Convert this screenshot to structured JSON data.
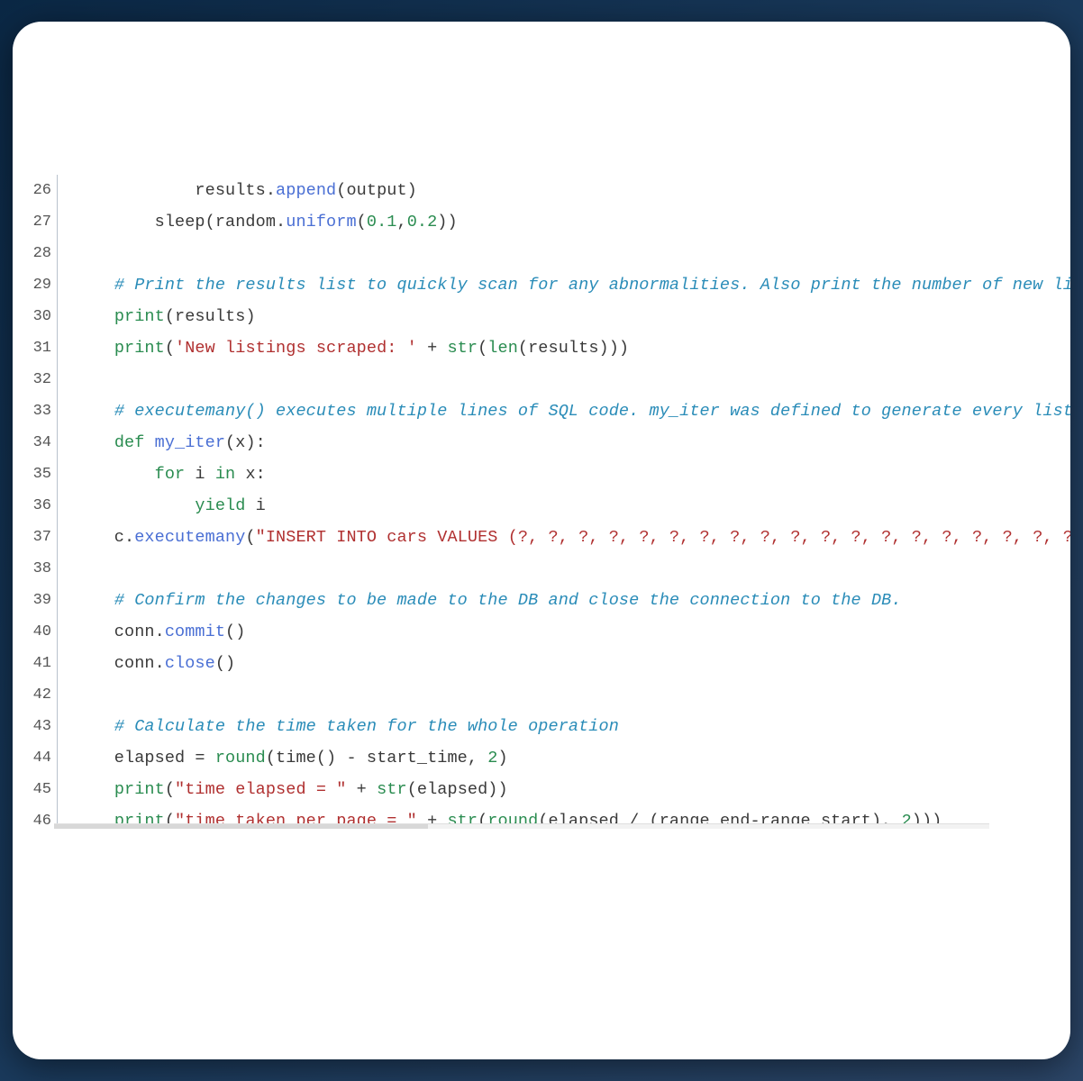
{
  "code": {
    "lines": [
      {
        "n": 26,
        "tokens": [
          {
            "t": "            results.",
            "c": "t-default"
          },
          {
            "t": "append",
            "c": "t-func"
          },
          {
            "t": "(output)",
            "c": "t-default"
          }
        ]
      },
      {
        "n": 27,
        "tokens": [
          {
            "t": "        sleep(random.",
            "c": "t-default"
          },
          {
            "t": "uniform",
            "c": "t-func"
          },
          {
            "t": "(",
            "c": "t-default"
          },
          {
            "t": "0.1",
            "c": "t-num"
          },
          {
            "t": ",",
            "c": "t-default"
          },
          {
            "t": "0.2",
            "c": "t-num"
          },
          {
            "t": "))",
            "c": "t-default"
          }
        ]
      },
      {
        "n": 28,
        "tokens": [
          {
            "t": "",
            "c": "t-default"
          }
        ]
      },
      {
        "n": 29,
        "tokens": [
          {
            "t": "    ",
            "c": "t-default"
          },
          {
            "t": "# Print the results list to quickly scan for any abnormalities. Also print the number of new li",
            "c": "t-comment"
          }
        ]
      },
      {
        "n": 30,
        "tokens": [
          {
            "t": "    ",
            "c": "t-default"
          },
          {
            "t": "print",
            "c": "t-builtin"
          },
          {
            "t": "(results)",
            "c": "t-default"
          }
        ]
      },
      {
        "n": 31,
        "tokens": [
          {
            "t": "    ",
            "c": "t-default"
          },
          {
            "t": "print",
            "c": "t-builtin"
          },
          {
            "t": "(",
            "c": "t-default"
          },
          {
            "t": "'New listings scraped: '",
            "c": "t-string"
          },
          {
            "t": " + ",
            "c": "t-default"
          },
          {
            "t": "str",
            "c": "t-builtin"
          },
          {
            "t": "(",
            "c": "t-default"
          },
          {
            "t": "len",
            "c": "t-builtin"
          },
          {
            "t": "(results)))",
            "c": "t-default"
          }
        ]
      },
      {
        "n": 32,
        "tokens": [
          {
            "t": "",
            "c": "t-default"
          }
        ]
      },
      {
        "n": 33,
        "tokens": [
          {
            "t": "    ",
            "c": "t-default"
          },
          {
            "t": "# executemany() executes multiple lines of SQL code. my_iter was defined to generate every list",
            "c": "t-comment"
          }
        ]
      },
      {
        "n": 34,
        "tokens": [
          {
            "t": "    ",
            "c": "t-default"
          },
          {
            "t": "def",
            "c": "t-keyword"
          },
          {
            "t": " ",
            "c": "t-default"
          },
          {
            "t": "my_iter",
            "c": "t-func"
          },
          {
            "t": "(x):",
            "c": "t-default"
          }
        ]
      },
      {
        "n": 35,
        "tokens": [
          {
            "t": "        ",
            "c": "t-default"
          },
          {
            "t": "for",
            "c": "t-keyword"
          },
          {
            "t": " i ",
            "c": "t-default"
          },
          {
            "t": "in",
            "c": "t-keyword"
          },
          {
            "t": " x:",
            "c": "t-default"
          }
        ]
      },
      {
        "n": 36,
        "tokens": [
          {
            "t": "            ",
            "c": "t-default"
          },
          {
            "t": "yield",
            "c": "t-keyword"
          },
          {
            "t": " i",
            "c": "t-default"
          }
        ]
      },
      {
        "n": 37,
        "tokens": [
          {
            "t": "    c.",
            "c": "t-default"
          },
          {
            "t": "executemany",
            "c": "t-func"
          },
          {
            "t": "(",
            "c": "t-default"
          },
          {
            "t": "\"INSERT INTO cars VALUES (?, ?, ?, ?, ?, ?, ?, ?, ?, ?, ?, ?, ?, ?, ?, ?, ?, ?, ?",
            "c": "t-string"
          }
        ]
      },
      {
        "n": 38,
        "tokens": [
          {
            "t": "",
            "c": "t-default"
          }
        ]
      },
      {
        "n": 39,
        "tokens": [
          {
            "t": "    ",
            "c": "t-default"
          },
          {
            "t": "# Confirm the changes to be made to the DB and close the connection to the DB.",
            "c": "t-comment"
          }
        ]
      },
      {
        "n": 40,
        "tokens": [
          {
            "t": "    conn.",
            "c": "t-default"
          },
          {
            "t": "commit",
            "c": "t-func"
          },
          {
            "t": "()",
            "c": "t-default"
          }
        ]
      },
      {
        "n": 41,
        "tokens": [
          {
            "t": "    conn.",
            "c": "t-default"
          },
          {
            "t": "close",
            "c": "t-func"
          },
          {
            "t": "()",
            "c": "t-default"
          }
        ]
      },
      {
        "n": 42,
        "tokens": [
          {
            "t": "",
            "c": "t-default"
          }
        ]
      },
      {
        "n": 43,
        "tokens": [
          {
            "t": "    ",
            "c": "t-default"
          },
          {
            "t": "# Calculate the time taken for the whole operation",
            "c": "t-comment"
          }
        ]
      },
      {
        "n": 44,
        "tokens": [
          {
            "t": "    elapsed = ",
            "c": "t-default"
          },
          {
            "t": "round",
            "c": "t-builtin"
          },
          {
            "t": "(time() - start_time, ",
            "c": "t-default"
          },
          {
            "t": "2",
            "c": "t-num"
          },
          {
            "t": ")",
            "c": "t-default"
          }
        ]
      },
      {
        "n": 45,
        "tokens": [
          {
            "t": "    ",
            "c": "t-default"
          },
          {
            "t": "print",
            "c": "t-builtin"
          },
          {
            "t": "(",
            "c": "t-default"
          },
          {
            "t": "\"time elapsed = \"",
            "c": "t-string"
          },
          {
            "t": " + ",
            "c": "t-default"
          },
          {
            "t": "str",
            "c": "t-builtin"
          },
          {
            "t": "(elapsed))",
            "c": "t-default"
          }
        ]
      },
      {
        "n": 46,
        "tokens": [
          {
            "t": "    ",
            "c": "t-default"
          },
          {
            "t": "print",
            "c": "t-builtin"
          },
          {
            "t": "(",
            "c": "t-default"
          },
          {
            "t": "\"time taken per page = \"",
            "c": "t-string"
          },
          {
            "t": " + ",
            "c": "t-default"
          },
          {
            "t": "str",
            "c": "t-builtin"
          },
          {
            "t": "(",
            "c": "t-default"
          },
          {
            "t": "round",
            "c": "t-builtin"
          },
          {
            "t": "(elapsed / (range_end-range_start), ",
            "c": "t-default"
          },
          {
            "t": "2",
            "c": "t-num"
          },
          {
            "t": ")))",
            "c": "t-default"
          }
        ]
      }
    ]
  }
}
